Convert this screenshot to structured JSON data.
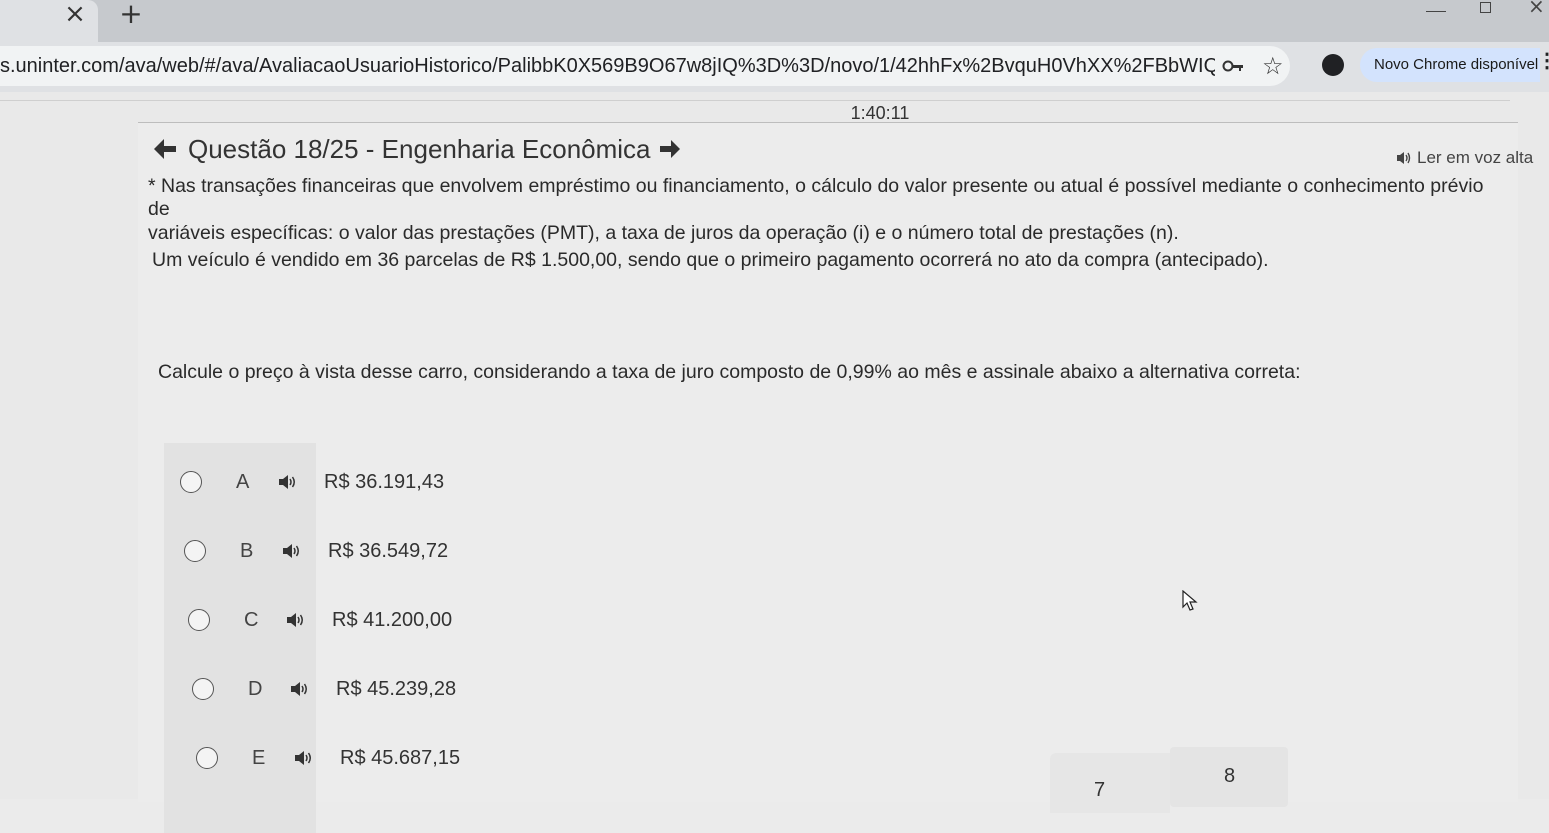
{
  "browser": {
    "tab_close": "×",
    "tab_new": "+",
    "url": "s.uninter.com/ava/web/#/ava/AvaliacaoUsuarioHistorico/PalibbK0X569B9O67w8jIQ%3D%3D/novo/1/42hhFx%2BvquH0VhXX%2FBbWIQ...",
    "update_chip": "Novo Chrome disponível",
    "menu_dots": "⋮",
    "star": "☆"
  },
  "page": {
    "timer": "1:40:11",
    "question_title": "Questão 18/25 - Engenharia Econômica",
    "read_aloud": "Ler em voz alta",
    "statement": {
      "line1": "* Nas transações financeiras que envolvem empréstimo ou financiamento, o cálculo do valor presente ou atual é possível mediante o conhecimento prévio de",
      "line2": "variáveis específicas: o valor das prestações (PMT), a taxa de juros da operação (i) e o número total de prestações (n).",
      "line3": "Um veículo é vendido em 36 parcelas de R$ 1.500,00, sendo que o primeiro pagamento ocorrerá no ato da compra (antecipado)."
    },
    "prompt": "Calcule o preço à vista desse carro, considerando a taxa de juro composto de 0,99% ao mês e assinale abaixo a alternativa correta:",
    "options": [
      {
        "letter": "A",
        "value": "R$ 36.191,43"
      },
      {
        "letter": "B",
        "value": "R$ 36.549,72"
      },
      {
        "letter": "C",
        "value": "R$ 41.200,00"
      },
      {
        "letter": "D",
        "value": "R$ 45.239,28"
      },
      {
        "letter": "E",
        "value": "R$ 45.687,15"
      }
    ],
    "pager": {
      "prev": "7",
      "next": "8"
    }
  },
  "colors": {
    "tab_strip": "#c6c9cd",
    "toolbar": "#dfe1e4",
    "page_bg": "#e9e9e9",
    "update_chip": "#d3e3fd"
  },
  "icons": {
    "back": "arrow-left-icon",
    "forward": "arrow-right-icon",
    "speaker": "speaker-icon",
    "key": "key-icon",
    "star": "star-icon"
  }
}
